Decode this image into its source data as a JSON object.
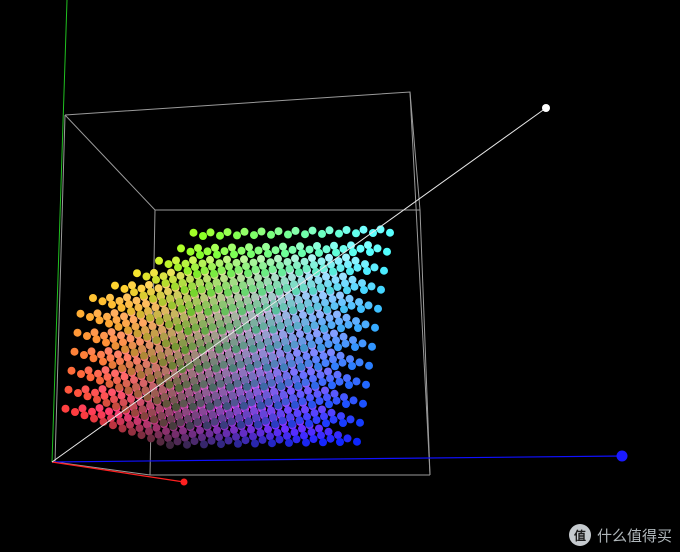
{
  "scene": {
    "background": "#000000",
    "axis_colors": {
      "x": "#ff2020",
      "y": "#20c020",
      "z": "#1010ff",
      "diagonal": "#e8e8e8"
    },
    "box_color": "#9a9a9a",
    "point_cloud": {
      "description_type": "rgb-color-cube-gamut",
      "grid_steps": 12
    }
  },
  "watermark": {
    "logo_icon": "zhihu-logo",
    "badge_text": "值",
    "text": "什么值得买"
  }
}
